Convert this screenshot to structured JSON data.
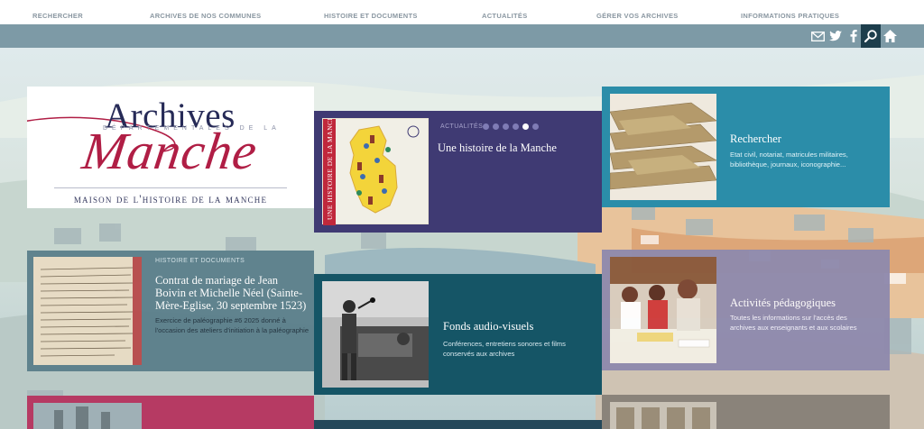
{
  "nav": {
    "items": [
      "RECHERCHER",
      "ARCHIVES DE NOS COMMUNES",
      "HISTOIRE ET DOCUMENTS",
      "ACTUALITÉS",
      "GÉRER VOS ARCHIVES",
      "INFORMATIONS PRATIQUES"
    ]
  },
  "toolbar": {
    "icons": [
      "mail-icon",
      "twitter-icon",
      "facebook-icon",
      "search-icon",
      "home-icon"
    ],
    "accent": "#1d3e4c"
  },
  "logo": {
    "title": "Archives",
    "subtitle": "DÉPARTEMENTALES DE LA",
    "script": "Manche",
    "footer": "maison de l'histoire de la manche"
  },
  "news": {
    "kicker": "ACTUALITÉS",
    "dots": 6,
    "active_dot": 4,
    "title": "Une histoire de la Manche",
    "image_text": "UNE HISTOIRE DE LA MANCHE"
  },
  "search_tile": {
    "title": "Rechercher",
    "desc_line1": "Etat civil, notariat, matricules militaires,",
    "desc_line2": "bibliothèque, journaux, iconographie..."
  },
  "history_tile": {
    "kicker": "HISTOIRE ET DOCUMENTS",
    "title": "Contrat de mariage de Jean Boivin et Michelle Néel (Sainte-Mère-Eglise, 30 septembre 1523)",
    "desc": "Exercice de paléographie #6 2025 donné à l'occasion des ateliers d'initiation à la paléographie"
  },
  "audio_tile": {
    "title": "Fonds audio-visuels",
    "desc_line1": "Conférences, entretiens sonores et films",
    "desc_line2": "conservés aux archives"
  },
  "activities_tile": {
    "title": "Activités pédagogiques",
    "desc_line1": "Toutes les informations sur l'accès des",
    "desc_line2": "archives aux enseignants et aux scolaires"
  },
  "colors": {
    "navy": "#3f3a73",
    "teal": "#2b8da9",
    "dark_teal": "#155566",
    "lavender": "#8f8aad",
    "crimson": "#b01e45"
  }
}
